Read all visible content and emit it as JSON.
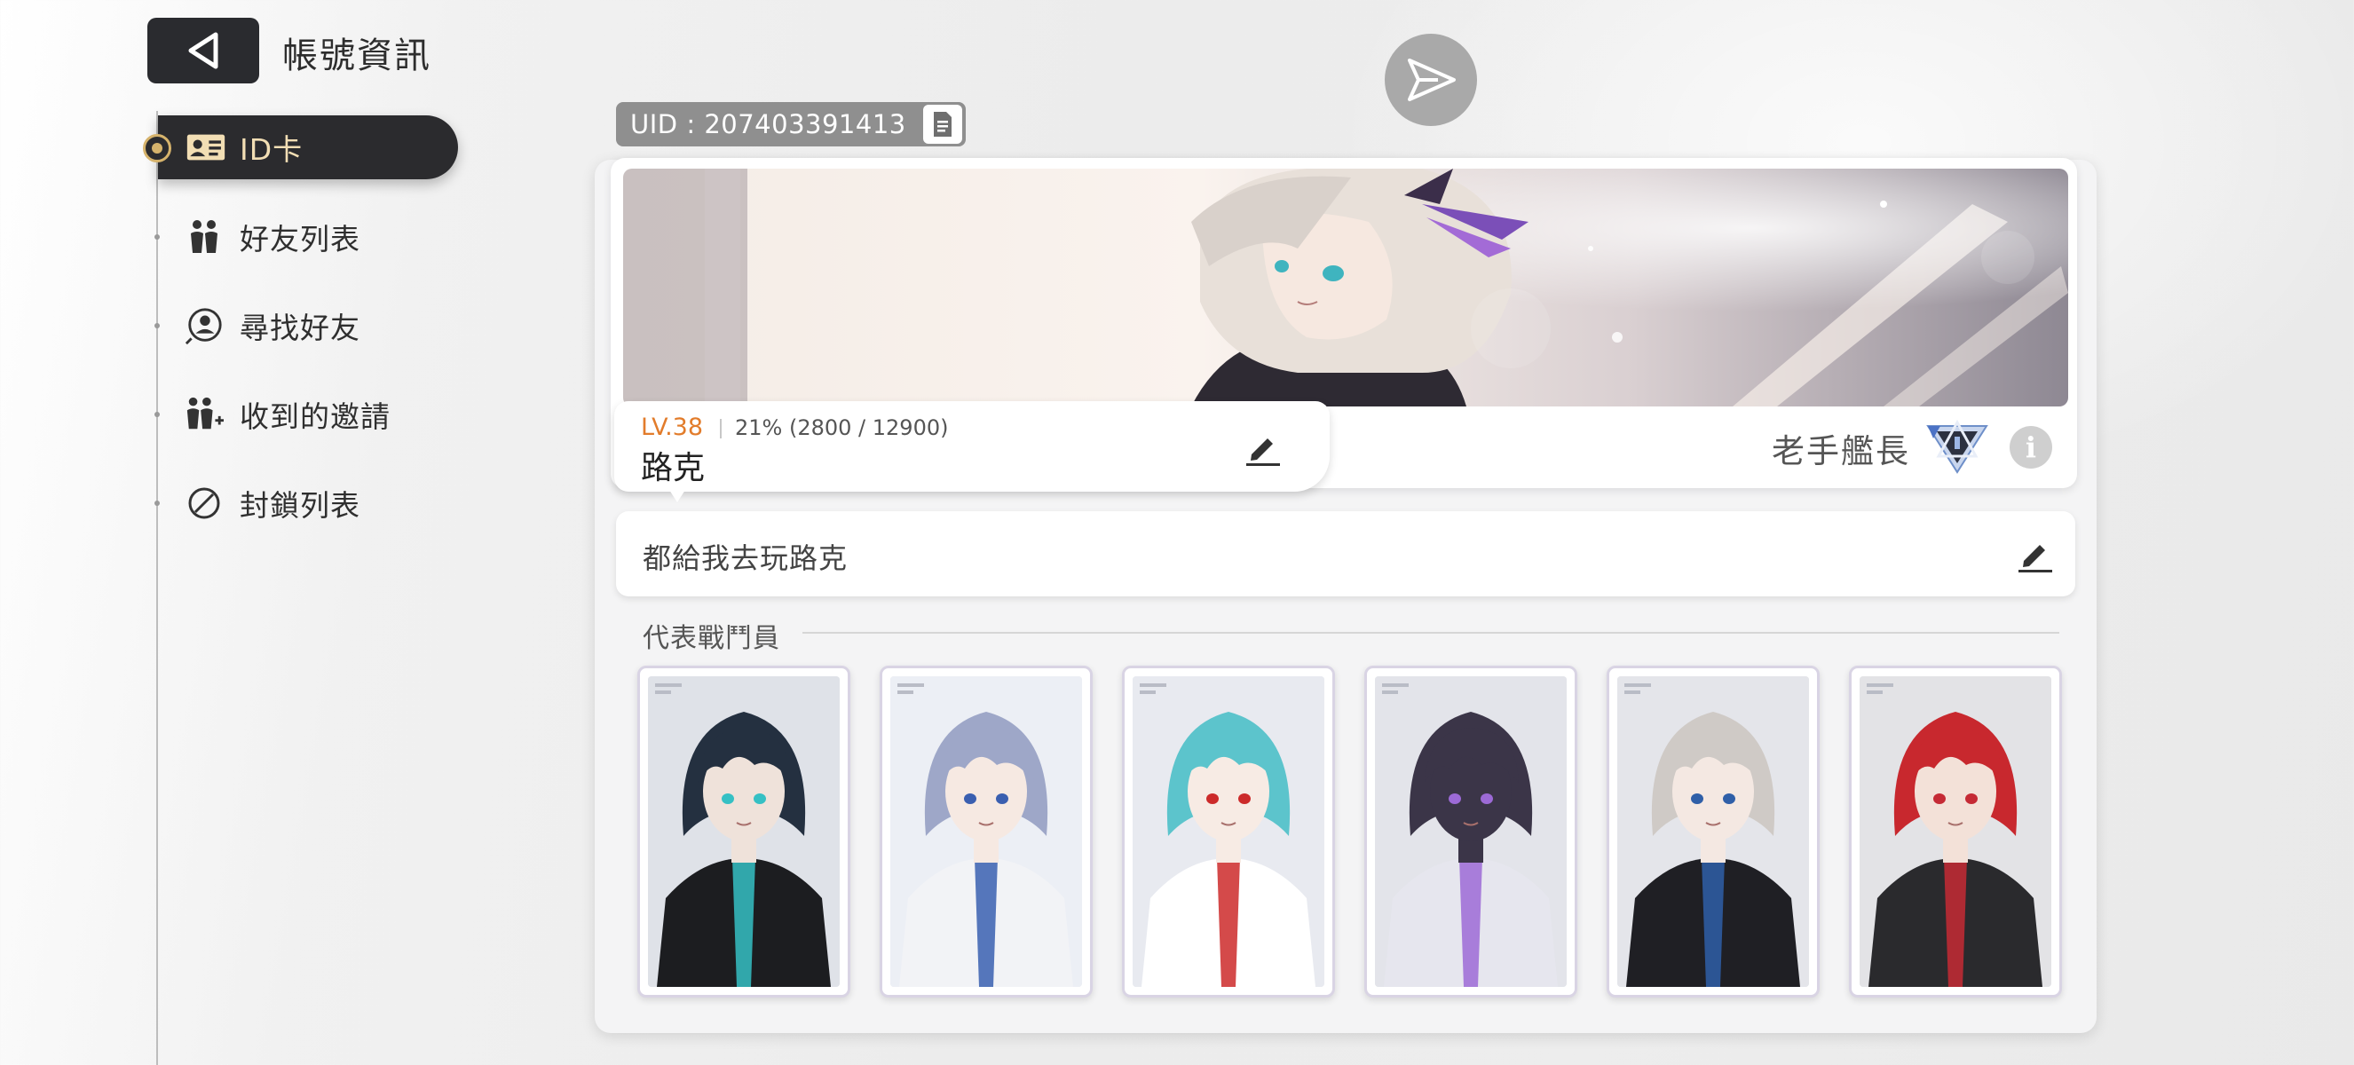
{
  "header": {
    "title": "帳號資訊",
    "back_icon": "back-triangle-icon",
    "send_icon": "send-icon"
  },
  "sidebar": {
    "items": [
      {
        "label": "ID卡",
        "icon": "id-card-icon",
        "active": true
      },
      {
        "label": "好友列表",
        "icon": "friends-icon",
        "active": false
      },
      {
        "label": "尋找好友",
        "icon": "find-friend-icon",
        "active": false
      },
      {
        "label": "收到的邀請",
        "icon": "invite-icon",
        "active": false
      },
      {
        "label": "封鎖列表",
        "icon": "block-icon",
        "active": false
      }
    ]
  },
  "profile": {
    "uid": "UID : 207403391413",
    "level": "LV.38",
    "exp": "21% (2800 / 12900)",
    "exp_fraction": 0.21,
    "name": "路克",
    "rank_title": "老手艦長",
    "bio": "都給我去玩路克"
  },
  "representatives": {
    "title": "代表戰鬥員",
    "characters": [
      {
        "hair": "#243040",
        "skin": "#efe2da",
        "outfit": "#1c1d20",
        "accent": "#35c0c4",
        "bg": "#dfe2e8"
      },
      {
        "hair": "#9ea7c8",
        "skin": "#f6e9e2",
        "outfit": "#f2f3f6",
        "accent": "#3a5fb0",
        "bg": "#eceff5"
      },
      {
        "hair": "#5cc4cc",
        "skin": "#f7ebe4",
        "outfit": "#ffffff",
        "accent": "#cc2a2a",
        "bg": "#e8eaf0"
      },
      {
        "hair": "#3b3548",
        "skin": "#3b3548",
        "outfit": "#e6e6ee",
        "accent": "#9c6ad6",
        "bg": "#e3e4ea"
      },
      {
        "hair": "#cfcac6",
        "skin": "#f4e8e2",
        "outfit": "#1f1f24",
        "accent": "#2f5fa8",
        "bg": "#e4e5ea"
      },
      {
        "hair": "#c8282e",
        "skin": "#f3e1d8",
        "outfit": "#2a2a2d",
        "accent": "#c52a35",
        "bg": "#e3e3e6"
      }
    ]
  },
  "colors": {
    "level_text": "#e27c2b",
    "active_label": "#f2deb4",
    "active_marker": "#d6b36c"
  }
}
